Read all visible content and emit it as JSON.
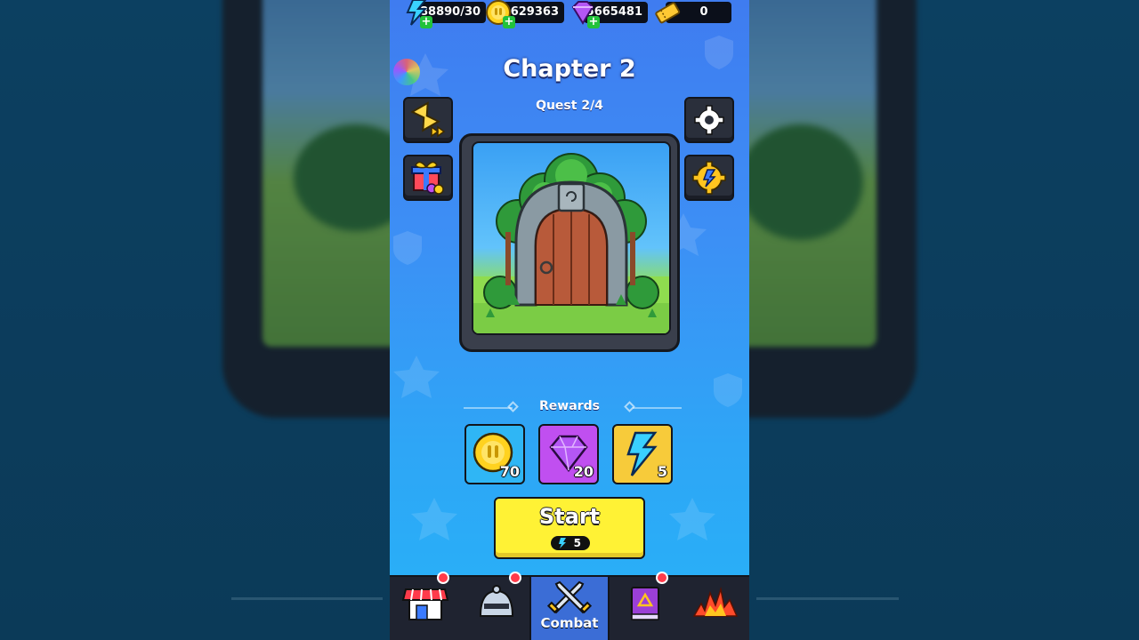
{
  "resources": {
    "energy": "88890/30",
    "coins": "3629363",
    "gems": "5665481",
    "tickets": "0"
  },
  "chapter": {
    "title": "Chapter 2",
    "quest": "Quest 2/4"
  },
  "rewards": {
    "label": "Rewards",
    "items": [
      {
        "type": "coin",
        "amount": "70"
      },
      {
        "type": "gem",
        "amount": "20"
      },
      {
        "type": "energy",
        "amount": "5"
      }
    ]
  },
  "start": {
    "label": "Start",
    "cost": "5"
  },
  "nav": {
    "items": [
      {
        "name": "shop",
        "icon": "shop-icon",
        "badge": true
      },
      {
        "name": "equipment",
        "icon": "helmet-icon",
        "badge": true
      },
      {
        "name": "combat",
        "label": "Combat",
        "icon": "crossed-swords-icon",
        "active": true,
        "badge": false
      },
      {
        "name": "book",
        "icon": "spellbook-icon",
        "badge": true
      },
      {
        "name": "event",
        "icon": "fire-icon",
        "badge": false
      }
    ]
  },
  "colors": {
    "phone_bg_top": "#3f7cf0",
    "phone_bg_bottom": "#27b2f8",
    "start_button": "#fff235",
    "coin_tile": "#2fb6f5",
    "gem_tile": "#c04ff0",
    "energy_tile": "#f7cb3a",
    "nav_bg": "#1f2330",
    "nav_active": "#3b6dd6"
  }
}
